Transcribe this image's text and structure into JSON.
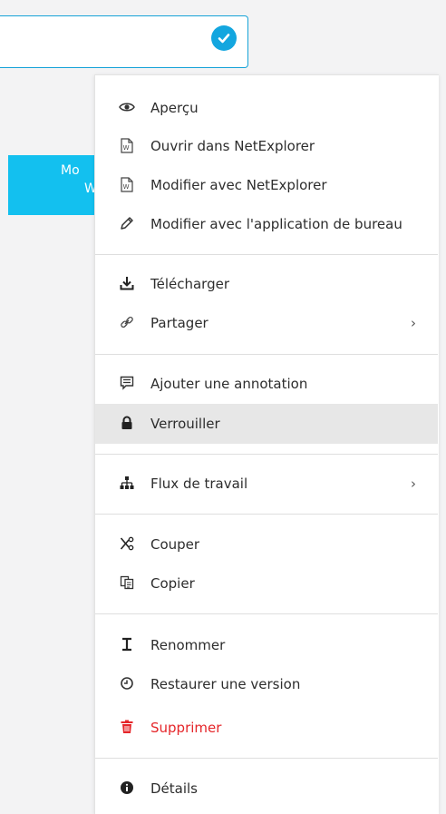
{
  "banner": {
    "line1": "Mo",
    "line2": "W"
  },
  "menu": {
    "items": [
      {
        "label": "Aperçu",
        "icon": "eye-icon"
      },
      {
        "label": "Ouvrir dans NetExplorer",
        "icon": "word-doc-icon"
      },
      {
        "label": "Modifier avec NetExplorer",
        "icon": "word-doc-icon"
      },
      {
        "label": "Modifier avec l'application de bureau",
        "icon": "pencil-icon"
      },
      {
        "label": "Télécharger",
        "icon": "download-icon"
      },
      {
        "label": "Partager",
        "icon": "link-icon",
        "chevron": "›"
      },
      {
        "label": "Ajouter une annotation",
        "icon": "comment-icon"
      },
      {
        "label": "Verrouiller",
        "icon": "lock-icon",
        "state": "hover"
      },
      {
        "label": "Flux de travail",
        "icon": "sitemap-icon",
        "chevron": "›"
      },
      {
        "label": "Couper",
        "icon": "scissors-icon"
      },
      {
        "label": "Copier",
        "icon": "copy-icon"
      },
      {
        "label": "Renommer",
        "icon": "text-cursor-icon"
      },
      {
        "label": "Restaurer une version",
        "icon": "clock-icon"
      },
      {
        "label": "Supprimer",
        "icon": "trash-icon",
        "state": "danger"
      },
      {
        "label": "Détails",
        "icon": "info-icon"
      }
    ]
  },
  "colors": {
    "accent": "#13a6df",
    "banner": "#13c0ef",
    "danger": "#e5262a",
    "hover": "#e7e7e7"
  }
}
